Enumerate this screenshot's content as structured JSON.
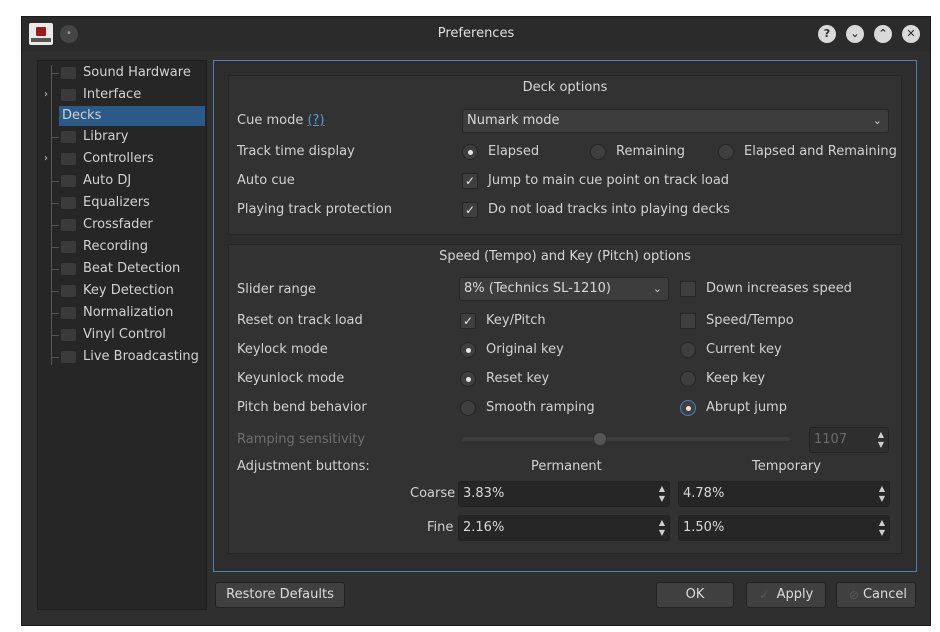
{
  "window": {
    "title": "Preferences",
    "logo": "mixxx-logo"
  },
  "titlebar_buttons": {
    "help": "?",
    "minimize": "⌄",
    "maximize": "⌃",
    "close": "✕"
  },
  "sidebar": {
    "items": [
      {
        "label": "Sound Hardware",
        "icon": "speaker-icon",
        "expandable": false
      },
      {
        "label": "Interface",
        "icon": "interface-icon",
        "expandable": true
      },
      {
        "label": "Decks",
        "icon": "",
        "expandable": false,
        "selected": true
      },
      {
        "label": "Library",
        "icon": "library-icon",
        "expandable": false
      },
      {
        "label": "Controllers",
        "icon": "controller-icon",
        "expandable": true
      },
      {
        "label": "Auto DJ",
        "icon": "autodj-icon",
        "expandable": false
      },
      {
        "label": "Equalizers",
        "icon": "equalizer-icon",
        "expandable": false
      },
      {
        "label": "Crossfader",
        "icon": "crossfader-icon",
        "expandable": false
      },
      {
        "label": "Recording",
        "icon": "recording-icon",
        "expandable": false
      },
      {
        "label": "Beat Detection",
        "icon": "beat-icon",
        "expandable": false
      },
      {
        "label": "Key Detection",
        "icon": "key-icon",
        "expandable": false
      },
      {
        "label": "Normalization",
        "icon": "normalization-icon",
        "expandable": false
      },
      {
        "label": "Vinyl Control",
        "icon": "vinyl-icon",
        "expandable": false
      },
      {
        "label": "Live Broadcasting",
        "icon": "broadcast-icon",
        "expandable": false
      }
    ]
  },
  "deck_options": {
    "title": "Deck options",
    "cue_mode": {
      "label": "Cue mode",
      "help": "(?)",
      "value": "Numark mode"
    },
    "track_time": {
      "label": "Track time display",
      "elapsed": "Elapsed",
      "remaining": "Remaining",
      "both": "Elapsed and Remaining",
      "selected": "elapsed"
    },
    "auto_cue": {
      "label": "Auto cue",
      "option": "Jump to main cue point on track load",
      "checked": true
    },
    "protection": {
      "label": "Playing track protection",
      "option": "Do not load tracks into playing decks",
      "checked": true
    }
  },
  "speed_options": {
    "title": "Speed (Tempo) and Key (Pitch) options",
    "slider_range": {
      "label": "Slider range",
      "value": "8% (Technics SL-1210)",
      "down_label": "Down increases speed",
      "down_checked": false
    },
    "reset": {
      "label": "Reset on track load",
      "key": "Key/Pitch",
      "key_checked": true,
      "speed": "Speed/Tempo",
      "speed_checked": false
    },
    "keylock": {
      "label": "Keylock mode",
      "original": "Original key",
      "current": "Current key",
      "selected": "original"
    },
    "keyunlock": {
      "label": "Keyunlock mode",
      "reset": "Reset key",
      "keep": "Keep key",
      "selected": "reset"
    },
    "pitchbend": {
      "label": "Pitch bend behavior",
      "smooth": "Smooth ramping",
      "abrupt": "Abrupt jump",
      "selected": "abrupt"
    },
    "ramping": {
      "label": "Ramping sensitivity",
      "value": "1107",
      "slider_fraction": 0.42
    },
    "adjust": {
      "label": "Adjustment buttons:",
      "permanent": "Permanent",
      "temporary": "Temporary",
      "coarse": {
        "label": "Coarse",
        "permanent": "3.83%",
        "temporary": "4.78%"
      },
      "fine": {
        "label": "Fine",
        "permanent": "2.16%",
        "temporary": "1.50%"
      }
    }
  },
  "buttons": {
    "restore": "Restore Defaults",
    "ok": "OK",
    "apply": "Apply",
    "cancel": "Cancel"
  },
  "colors": {
    "accent": "#4a82b8",
    "selection": "#2c5a88",
    "background": "#2f2f2f"
  }
}
